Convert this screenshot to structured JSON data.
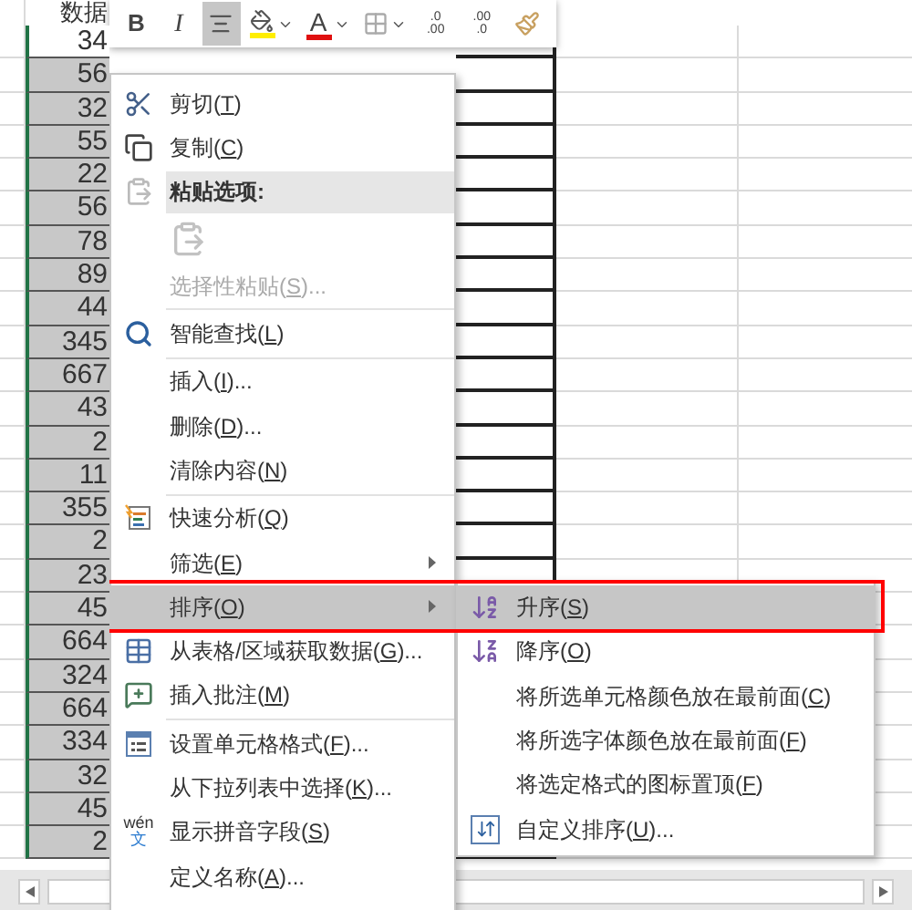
{
  "sheet": {
    "header": "数据",
    "cells": [
      {
        "value": "34",
        "selected": false
      },
      {
        "value": "56",
        "selected": true
      },
      {
        "value": "32",
        "selected": true
      },
      {
        "value": "55",
        "selected": true
      },
      {
        "value": "22",
        "selected": true
      },
      {
        "value": "56",
        "selected": true
      },
      {
        "value": "78",
        "selected": true
      },
      {
        "value": "89",
        "selected": true
      },
      {
        "value": "44",
        "selected": true
      },
      {
        "value": "345",
        "selected": true
      },
      {
        "value": "667",
        "selected": true
      },
      {
        "value": "43",
        "selected": true
      },
      {
        "value": "2",
        "selected": true
      },
      {
        "value": "11",
        "selected": true
      },
      {
        "value": "355",
        "selected": true
      },
      {
        "value": "2",
        "selected": true
      },
      {
        "value": "23",
        "selected": true
      },
      {
        "value": "45",
        "selected": true
      },
      {
        "value": "664",
        "selected": true
      },
      {
        "value": "324",
        "selected": true
      },
      {
        "value": "664",
        "selected": true
      },
      {
        "value": "334",
        "selected": true
      },
      {
        "value": "32",
        "selected": true
      },
      {
        "value": "45",
        "selected": true
      },
      {
        "value": "2",
        "selected": true
      }
    ]
  },
  "toolbar": [
    {
      "kind": "bold",
      "label": "B",
      "selected": false
    },
    {
      "kind": "italic",
      "label": "I",
      "selected": false
    },
    {
      "kind": "align",
      "selected": true
    },
    {
      "kind": "fill",
      "selected": false
    },
    {
      "kind": "font-color",
      "label": "A",
      "selected": false
    },
    {
      "kind": "borders",
      "selected": false
    },
    {
      "kind": "increase-decimal",
      "texts": [
        ".0",
        ".00"
      ],
      "selected": false
    },
    {
      "kind": "decrease-decimal",
      "texts": [
        ".00",
        ".0"
      ],
      "selected": false
    },
    {
      "kind": "painter",
      "selected": false
    }
  ],
  "context_menu": [
    {
      "kind": "item",
      "label": "剪切(T)",
      "selected": false
    },
    {
      "kind": "item",
      "label": "复制(C)",
      "selected": false
    },
    {
      "kind": "header",
      "label": "粘贴选项:"
    },
    {
      "kind": "paste-icon"
    },
    {
      "kind": "item",
      "label": "选择性粘贴(S)...",
      "disabled": true,
      "selected": false
    },
    {
      "kind": "separator"
    },
    {
      "kind": "item",
      "label": "智能查找(L)",
      "selected": false
    },
    {
      "kind": "separator"
    },
    {
      "kind": "item",
      "label": "插入(I)...",
      "selected": false
    },
    {
      "kind": "item",
      "label": "删除(D)...",
      "selected": false
    },
    {
      "kind": "item",
      "label": "清除内容(N)",
      "selected": false
    },
    {
      "kind": "separator"
    },
    {
      "kind": "item",
      "label": "快速分析(Q)",
      "selected": false
    },
    {
      "kind": "item",
      "label": "筛选(E)",
      "submenu": true,
      "selected": false
    },
    {
      "kind": "item",
      "label": "排序(O)",
      "submenu": true,
      "selected": true
    },
    {
      "kind": "item",
      "label": "从表格/区域获取数据(G)...",
      "selected": false
    },
    {
      "kind": "item",
      "label": "插入批注(M)",
      "selected": false
    },
    {
      "kind": "separator"
    },
    {
      "kind": "item",
      "label": "设置单元格格式(F)...",
      "selected": false
    },
    {
      "kind": "item",
      "label": "从下拉列表中选择(K)...",
      "selected": false
    },
    {
      "kind": "item",
      "label": "显示拼音字段(S)",
      "icon_text": [
        "wén",
        "文"
      ],
      "selected": false
    },
    {
      "kind": "item",
      "label": "定义名称(A)...",
      "selected": false
    }
  ],
  "sort_submenu": [
    {
      "label": "升序(S)",
      "selected": true
    },
    {
      "label": "降序(O)",
      "selected": false
    },
    {
      "label": "将所选单元格颜色放在最前面(C)",
      "selected": false
    },
    {
      "label": "将所选字体颜色放在最前面(F)",
      "selected": false
    },
    {
      "label": "将选定格式的图标置顶(F)",
      "selected": false
    },
    {
      "label": "自定义排序(U)...",
      "selected": false
    }
  ]
}
